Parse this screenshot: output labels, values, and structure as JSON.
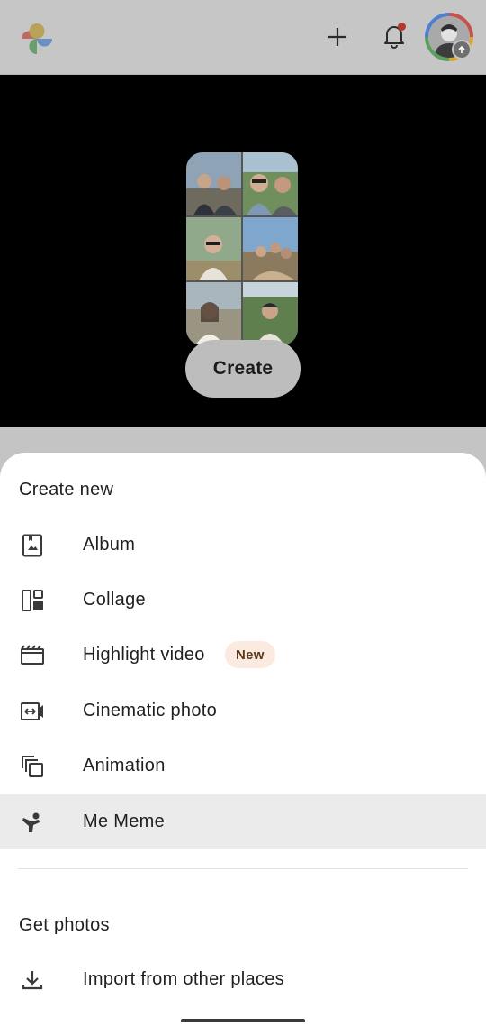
{
  "app_bar": {
    "logo_icon": "google-photos-pinwheel-icon",
    "add_icon": "plus-icon",
    "notifications_icon": "bell-icon",
    "avatar_icon": "profile-avatar"
  },
  "hero": {
    "create_button_label": "Create"
  },
  "sheet": {
    "create_section_title": "Create new",
    "create_items": [
      {
        "label": "Album",
        "icon": "album-icon"
      },
      {
        "label": "Collage",
        "icon": "collage-icon"
      },
      {
        "label": "Highlight video",
        "icon": "highlight-video-icon",
        "badge": "New"
      },
      {
        "label": "Cinematic photo",
        "icon": "cinematic-photo-icon"
      },
      {
        "label": "Animation",
        "icon": "animation-icon"
      },
      {
        "label": "Me Meme",
        "icon": "me-meme-icon"
      }
    ],
    "get_section_title": "Get photos",
    "get_items": [
      {
        "label": "Import from other places",
        "icon": "download-icon"
      }
    ]
  },
  "colors": {
    "scrim_bar": "#c6c6c6",
    "sheet_bg": "#ffffff",
    "highlight_row": "#ebebeb",
    "new_badge_bg": "#fbeadf",
    "notification_dot": "#b53a2e"
  }
}
